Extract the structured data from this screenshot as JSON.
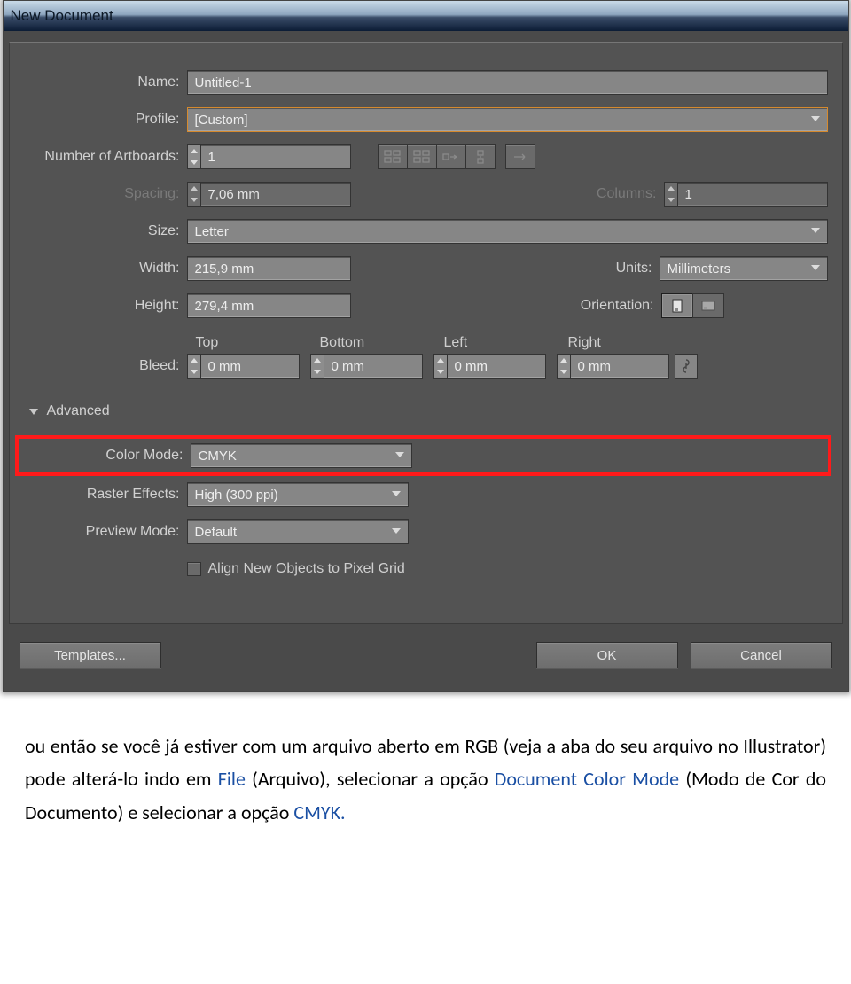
{
  "titlebar": {
    "title": "New Document"
  },
  "fields": {
    "name_label": "Name:",
    "name_value": "Untitled-1",
    "profile_label": "Profile:",
    "profile_value": "[Custom]",
    "artboards_label": "Number of Artboards:",
    "artboards_value": "1",
    "spacing_label": "Spacing:",
    "spacing_value": "7,06 mm",
    "columns_label": "Columns:",
    "columns_value": "1",
    "size_label": "Size:",
    "size_value": "Letter",
    "width_label": "Width:",
    "width_value": "215,9 mm",
    "units_label": "Units:",
    "units_value": "Millimeters",
    "height_label": "Height:",
    "height_value": "279,4 mm",
    "orientation_label": "Orientation:"
  },
  "bleed": {
    "label": "Bleed:",
    "top_label": "Top",
    "bottom_label": "Bottom",
    "left_label": "Left",
    "right_label": "Right",
    "top": "0 mm",
    "bottom": "0 mm",
    "left": "0 mm",
    "right": "0 mm"
  },
  "advanced": {
    "header": "Advanced",
    "colormode_label": "Color Mode:",
    "colormode_value": "CMYK",
    "raster_label": "Raster Effects:",
    "raster_value": "High (300 ppi)",
    "preview_label": "Preview Mode:",
    "preview_value": "Default",
    "align_label": "Align New Objects to Pixel Grid"
  },
  "buttons": {
    "templates": "Templates...",
    "ok": "OK",
    "cancel": "Cancel"
  },
  "document_text": {
    "seg1": "ou então se você já estiver com um arquivo aberto em RGB (veja a aba do seu arquivo no Illustrator) pode alterá-lo indo em ",
    "seg2": "File",
    "seg3": " (Arquivo), selecionar a opção ",
    "seg4": "Document Color Mode",
    "seg5": " (Modo de Cor do Documento) e selecionar a opção ",
    "seg6": "CMYK."
  }
}
